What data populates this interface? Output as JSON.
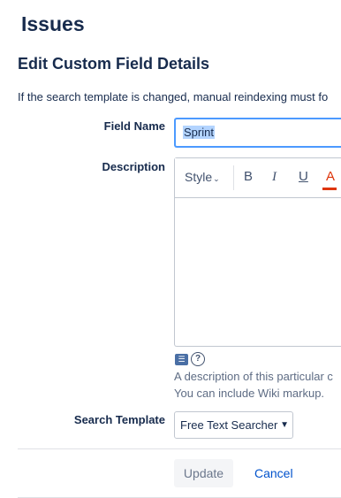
{
  "header": {
    "title": "Issues"
  },
  "form": {
    "title": "Edit Custom Field Details",
    "notice": "If the search template is changed, manual reindexing must fo",
    "field_name": {
      "label": "Field Name",
      "value": "Sprint"
    },
    "description": {
      "label": "Description",
      "toolbar": {
        "style_label": "Style",
        "bold_label": "B",
        "italic_label": "I",
        "underline_label": "U",
        "color_label": "A"
      },
      "wiki_icon": "wiki-markup-icon",
      "help_icon": "help-icon",
      "help_line1": "A description of this particular c",
      "help_line2": "You can include Wiki markup."
    },
    "search_template": {
      "label": "Search Template",
      "selected": "Free Text Searcher"
    },
    "buttons": {
      "update_label": "Update",
      "cancel_label": "Cancel"
    }
  },
  "colors": {
    "accent": "#0052cc",
    "focus_border": "#4c9aff",
    "text_color_red": "#de350b"
  }
}
